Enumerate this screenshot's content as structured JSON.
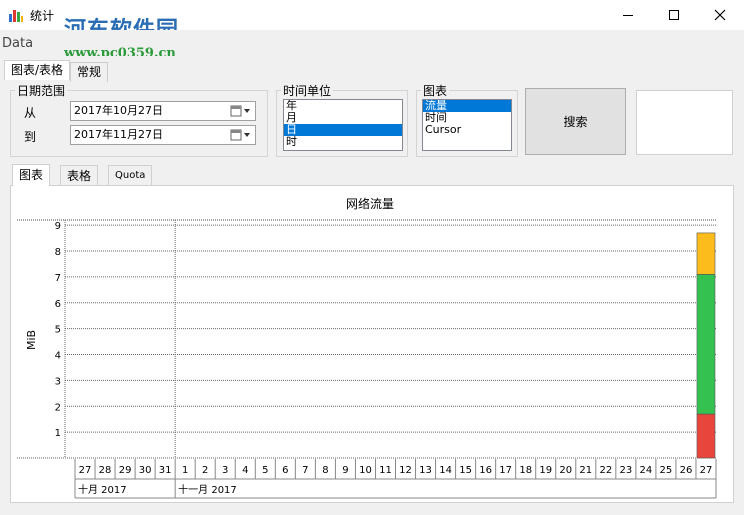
{
  "window": {
    "title": "统计",
    "watermark": "河东软件园",
    "watermark_url": "www.pc0359.cn",
    "data_label": "Data",
    "min_icon": "minimize-icon",
    "max_icon": "maximize-icon",
    "close_icon": "close-icon"
  },
  "outer_tabs": [
    {
      "label": "图表/表格"
    },
    {
      "label": "常规"
    }
  ],
  "date_range": {
    "legend": "日期范围",
    "from_label": "从",
    "from_value": "2017年10月27日",
    "to_label": "到",
    "to_value": "2017年11月27日"
  },
  "time_unit": {
    "legend": "时间单位",
    "options": [
      "年",
      "月",
      "日",
      "时"
    ],
    "selected": "日"
  },
  "chart_select": {
    "legend": "图表",
    "options": [
      "流量",
      "时间",
      "Cursor"
    ],
    "selected": "流量"
  },
  "search_button": "搜索",
  "inner_tabs": [
    {
      "label": "图表"
    },
    {
      "label": "表格"
    },
    {
      "label": "Quota"
    }
  ],
  "colors": {
    "accent": "#0078d7",
    "red": "#e8453c",
    "green": "#35c150",
    "orange": "#fbbc1c"
  },
  "chart_data": {
    "type": "bar",
    "title": "网络流量",
    "ylabel": "MiB",
    "xlabel": "",
    "ylim": [
      0,
      9
    ],
    "yticks": [
      1,
      2,
      3,
      4,
      5,
      6,
      7,
      8,
      9
    ],
    "grid": true,
    "categories": [
      "27",
      "28",
      "29",
      "30",
      "31",
      "1",
      "2",
      "3",
      "4",
      "5",
      "6",
      "7",
      "8",
      "9",
      "10",
      "11",
      "12",
      "13",
      "14",
      "15",
      "16",
      "17",
      "18",
      "19",
      "20",
      "21",
      "22",
      "23",
      "24",
      "25",
      "26",
      "27"
    ],
    "month_labels": [
      "十月 2017",
      "十一月 2017"
    ],
    "series": [
      {
        "color": "#e8453c",
        "values": [
          0,
          0,
          0,
          0,
          0,
          0,
          0,
          0,
          0,
          0,
          0,
          0,
          0,
          0,
          0,
          0,
          0,
          0,
          0,
          0,
          0,
          0,
          0,
          0,
          0,
          0,
          0,
          0,
          0,
          0,
          0,
          1.7
        ]
      },
      {
        "color": "#35c150",
        "values": [
          0,
          0,
          0,
          0,
          0,
          0,
          0,
          0,
          0,
          0,
          0,
          0,
          0,
          0,
          0,
          0,
          0,
          0,
          0,
          0,
          0,
          0,
          0,
          0,
          0,
          0,
          0,
          0,
          0,
          0,
          0,
          5.4
        ]
      },
      {
        "color": "#fbbc1c",
        "values": [
          0,
          0,
          0,
          0,
          0,
          0,
          0,
          0,
          0,
          0,
          0,
          0,
          0,
          0,
          0,
          0,
          0,
          0,
          0,
          0,
          0,
          0,
          0,
          0,
          0,
          0,
          0,
          0,
          0,
          0,
          0,
          1.6
        ]
      }
    ]
  }
}
